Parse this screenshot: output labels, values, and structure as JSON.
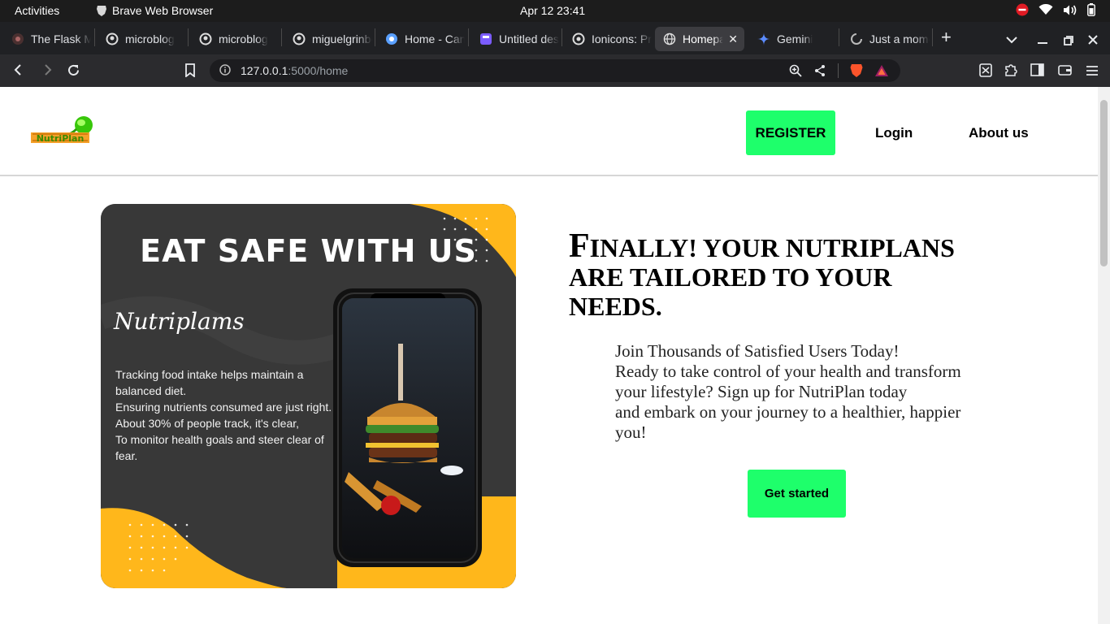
{
  "system": {
    "activities": "Activities",
    "app_name": "Brave Web Browser",
    "clock": "Apr 12  23:41"
  },
  "tabs": [
    {
      "title": "The Flask M",
      "icon": "flask-icon"
    },
    {
      "title": "microblog",
      "icon": "github-icon"
    },
    {
      "title": "microblog",
      "icon": "github-icon"
    },
    {
      "title": "miguelgrinberg",
      "icon": "github-icon"
    },
    {
      "title": "Home - Canva",
      "icon": "globe-icon"
    },
    {
      "title": "Untitled design",
      "icon": "canva-icon"
    },
    {
      "title": "Ionicons: Premium",
      "icon": "ionicons-icon"
    },
    {
      "title": "Homepage",
      "icon": "globe-icon",
      "active": true
    },
    {
      "title": "Gemini",
      "icon": "gemini-icon"
    },
    {
      "title": "Just a moment",
      "icon": "loading-icon"
    }
  ],
  "address_bar": {
    "host": "127.0.0.1",
    "path": ":5000/home"
  },
  "site": {
    "logo_text": "NutriPlan",
    "nav": {
      "register": "REGISTER",
      "login": "Login",
      "about": "About us"
    },
    "hero_card": {
      "headline": "EAT SAFE WITH US",
      "brand": "Nutriplams",
      "lines": [
        "Tracking food intake helps maintain a balanced diet.",
        "Ensuring nutrients consumed are just right.",
        "About 30% of people track, it's clear,",
        "To monitor health goals and steer clear of fear."
      ]
    },
    "hero": {
      "title": "Finally! Your NutriPlans are tailored to your needs.",
      "body_lines": [
        "Join Thousands of Satisfied Users Today!",
        "Ready to take control of your health and transform your lifestyle? Sign up for NutriPlan today",
        "and embark on your journey to a healthier, happier you!"
      ],
      "cta": "Get started"
    }
  },
  "colors": {
    "accent_green": "#1eff6b",
    "card_yellow": "#ffb71b",
    "card_dark": "#383838"
  }
}
